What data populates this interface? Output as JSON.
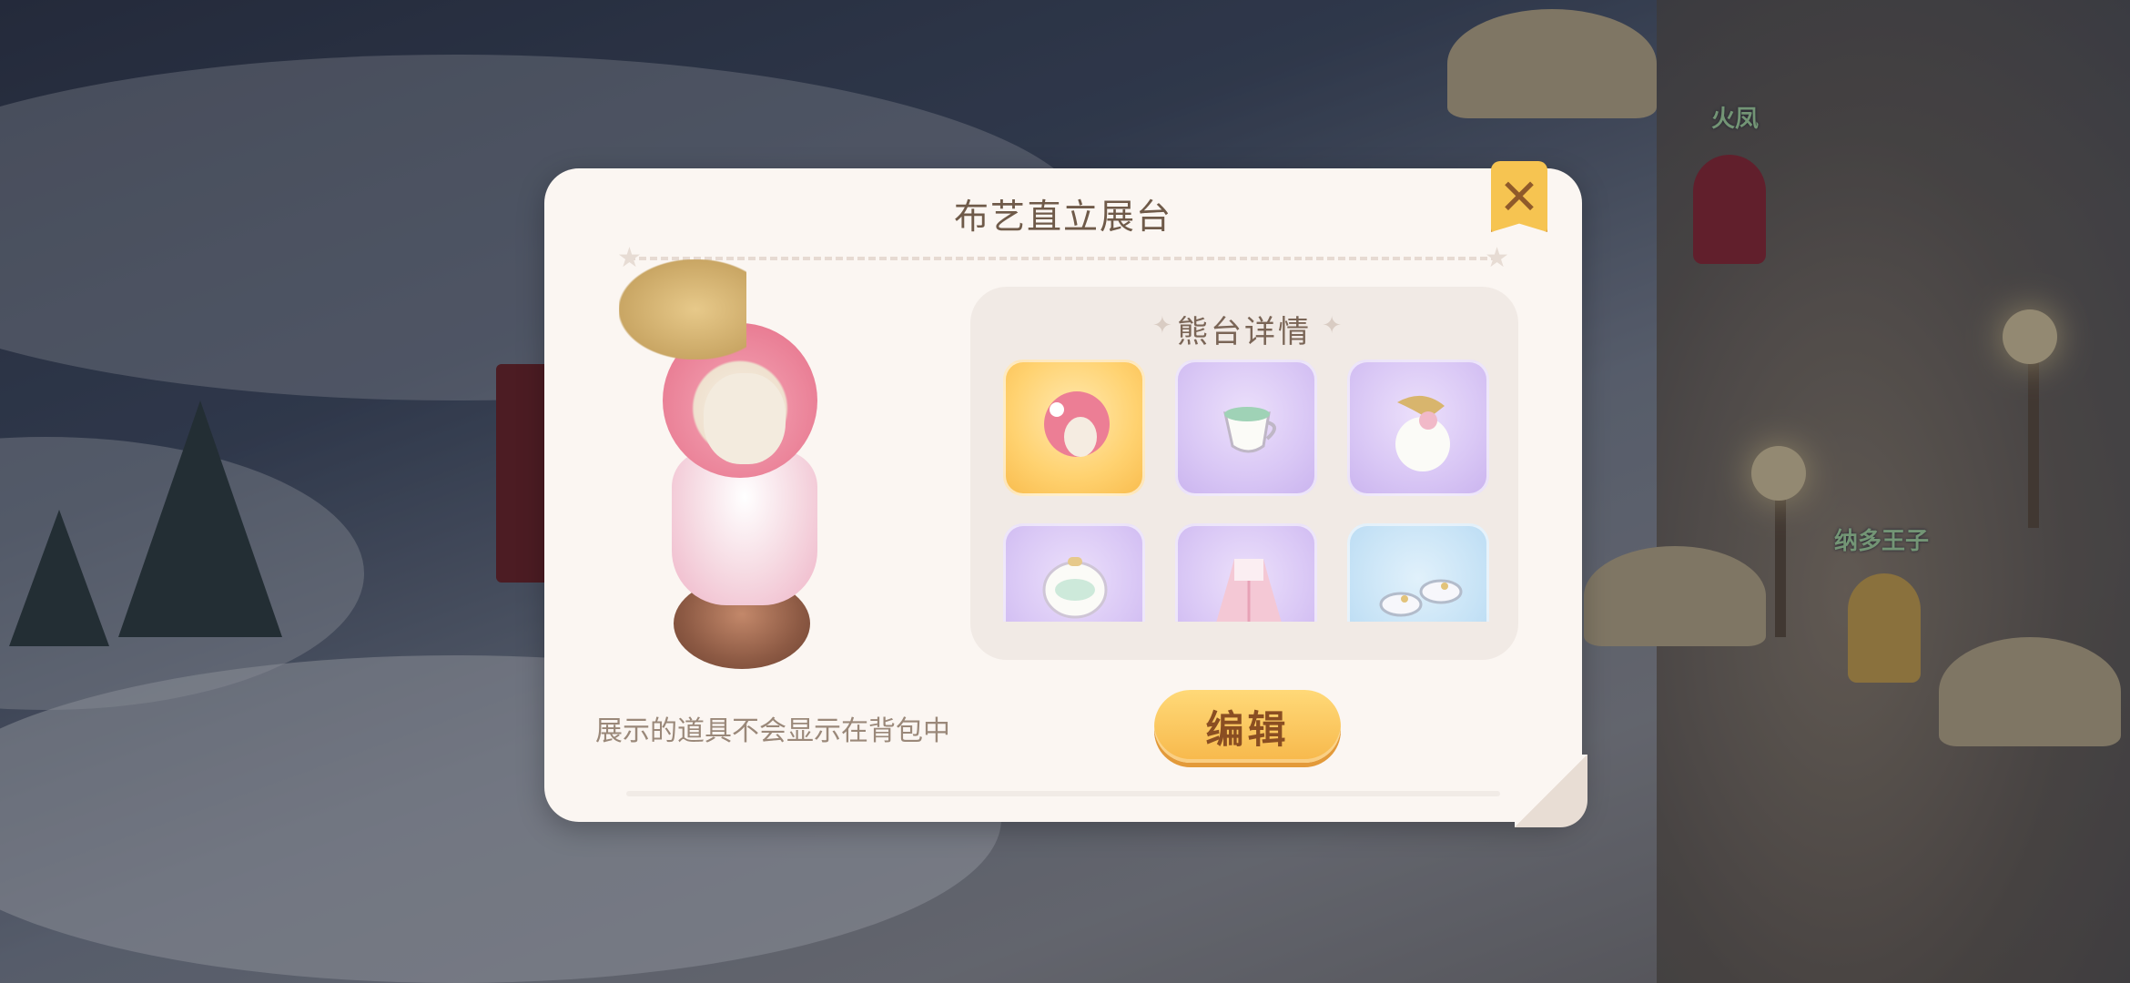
{
  "dialog": {
    "title": "布艺直立展台",
    "close_icon": "close-icon",
    "panel_title": "熊台详情",
    "note": "展示的道具不会显示在背包中",
    "edit_label": "编辑"
  },
  "items": [
    {
      "name": "pink-hair-item",
      "icon": "hair-icon",
      "tint": "gold"
    },
    {
      "name": "teacup-item",
      "icon": "teacup-icon",
      "tint": "purple"
    },
    {
      "name": "bird-hat-item",
      "icon": "bird-hat-icon",
      "tint": "purple"
    },
    {
      "name": "teapot-item",
      "icon": "teapot-icon",
      "tint": "purple"
    },
    {
      "name": "pink-dress-item",
      "icon": "dress-icon",
      "tint": "purple"
    },
    {
      "name": "shoes-item",
      "icon": "shoes-icon",
      "tint": "blue"
    }
  ],
  "scene": {
    "npc_names": [
      "火凤",
      "纳多王子"
    ]
  },
  "colors": {
    "dialog_bg": "#fbf6f2",
    "title_text": "#6f5a49",
    "close_button": "#f6c451",
    "edit_button": "#f7b84b"
  }
}
